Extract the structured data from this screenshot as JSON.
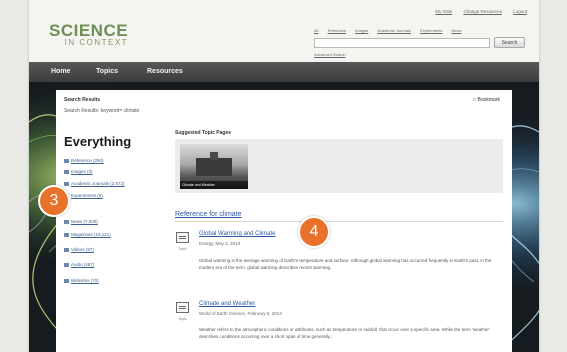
{
  "header": {
    "logo_prefix": "",
    "logo_main": "SCIENCE",
    "logo_sub": "IN CONTEXT",
    "top_links": [
      "My Gale",
      "Change Resources",
      "Logout"
    ],
    "search_tabs": [
      "All",
      "Reference",
      "Images",
      "Academic Journals",
      "Experiments",
      "News"
    ],
    "search_placeholder": "",
    "search_button": "Search",
    "advanced_search": "Advanced Search"
  },
  "nav": {
    "items": [
      "Home",
      "Topics",
      "Resources"
    ]
  },
  "results": {
    "heading": "Search Results",
    "subheading": "Search Results: keyword= climate",
    "bookmark": "Bookmark"
  },
  "sidebar": {
    "title": "Everything",
    "facets": [
      "Reference (290)",
      "Images (3)",
      "Academic Journals (2,672)",
      "Experiments (5)",
      "News (7,500)",
      "Magazines (19,121)",
      "Videos (87)",
      "Audio (487)",
      "Websites (70)"
    ]
  },
  "featured": {
    "label": "Suggested Topic Pages",
    "topic_caption": "Climate and Weather"
  },
  "reference": {
    "heading": "Reference for climate",
    "items": [
      {
        "title": "Global Warming and Climate",
        "meta": "Energy, May 2, 2013",
        "icon_label": "Topic",
        "text": "Global warming is the average warming of Earth's temperature and surface. Although global warming has occurred frequently in Earth's past, in the modern era of the term, global warming describes recent warming."
      },
      {
        "title": "Climate and Weather",
        "meta": "World of Earth Science, February 6, 2014",
        "icon_label": "Topic",
        "text": "Weather refers to the atmospheric conditions or attributes, such as temperature or rainfall, that occur over a specific area. While the term 'weather' describes conditions occurring over a short span of time generally..."
      }
    ]
  },
  "callouts": [
    "3",
    "4"
  ],
  "colors": {
    "accent": "#e8722a",
    "logo_green": "#6f8f55",
    "link_blue": "#2b5aa0",
    "nav_dark": "#4a4a4c"
  }
}
